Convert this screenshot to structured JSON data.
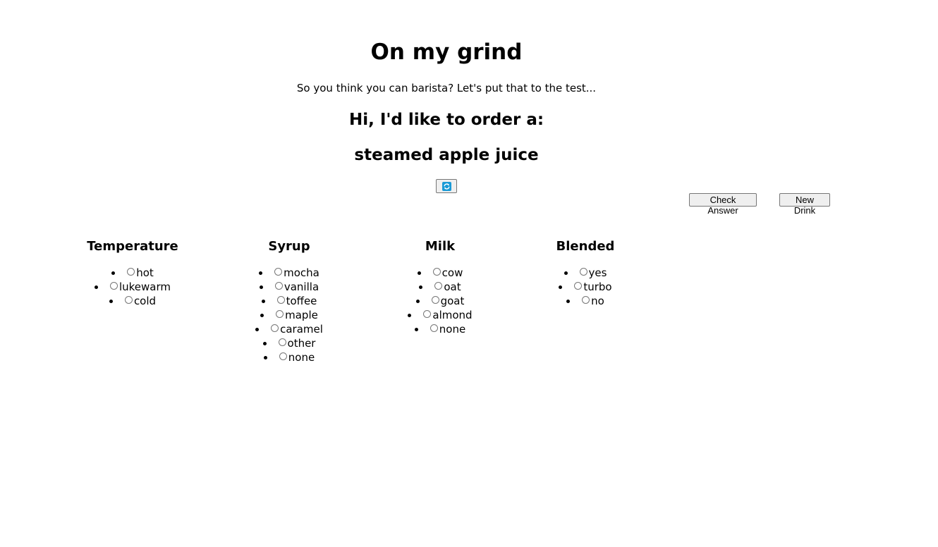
{
  "header": {
    "title": "On my grind",
    "subtitle": "So you think you can barista? Let's put that to the test...",
    "order_prompt": "Hi, I'd like to order a:",
    "drink_name": "steamed apple juice"
  },
  "actions": {
    "refresh_icon": "refresh-icon",
    "check_answer_label": "Check Answer",
    "new_drink_label": "New Drink"
  },
  "colors": {
    "refresh_icon": "#1a9ad6"
  },
  "groups": {
    "temperature": {
      "title": "Temperature",
      "options": [
        "hot",
        "lukewarm",
        "cold"
      ]
    },
    "syrup": {
      "title": "Syrup",
      "options": [
        "mocha",
        "vanilla",
        "toffee",
        "maple",
        "caramel",
        "other",
        "none"
      ]
    },
    "milk": {
      "title": "Milk",
      "options": [
        "cow",
        "oat",
        "goat",
        "almond",
        "none"
      ]
    },
    "blended": {
      "title": "Blended",
      "options": [
        "yes",
        "turbo",
        "no"
      ]
    }
  }
}
